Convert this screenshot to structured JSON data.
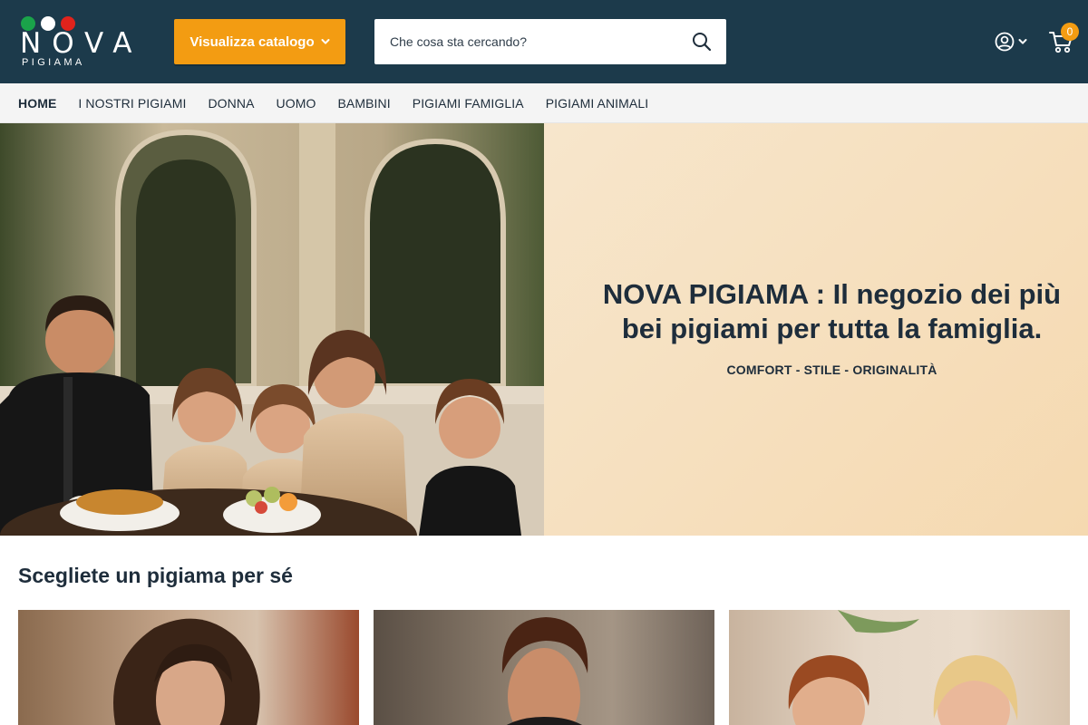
{
  "brand": {
    "logo_word": "NOVA",
    "logo_sub": "PIGIAMA",
    "colors": {
      "header": "#1c3a4b",
      "accent": "#f39c12",
      "logo_dots": [
        "#1aa34a",
        "#ffffff",
        "#e0231c"
      ]
    }
  },
  "header": {
    "catalog_label": "Visualizza catalogo",
    "search_placeholder": "Che cosa sta cercando?",
    "cart_count": "0",
    "icons": {
      "search": "search-icon",
      "account": "user-circle-icon",
      "cart": "cart-icon",
      "chevron": "chevron-down-icon"
    }
  },
  "nav": {
    "items": [
      {
        "label": "HOME",
        "active": true
      },
      {
        "label": "I NOSTRI PIGIAMI"
      },
      {
        "label": "DONNA"
      },
      {
        "label": "UOMO"
      },
      {
        "label": "BAMBINI"
      },
      {
        "label": "PIGIAMI FAMIGLIA"
      },
      {
        "label": "PIGIAMI ANIMALI"
      }
    ]
  },
  "hero": {
    "title": "NOVA PIGIAMA : Il negozio dei più bei pigiami per tutta la famiglia.",
    "subtitle": "COMFORT - STILE - ORIGINALITÀ"
  },
  "section": {
    "title": "Scegliete un pigiama per sé"
  }
}
